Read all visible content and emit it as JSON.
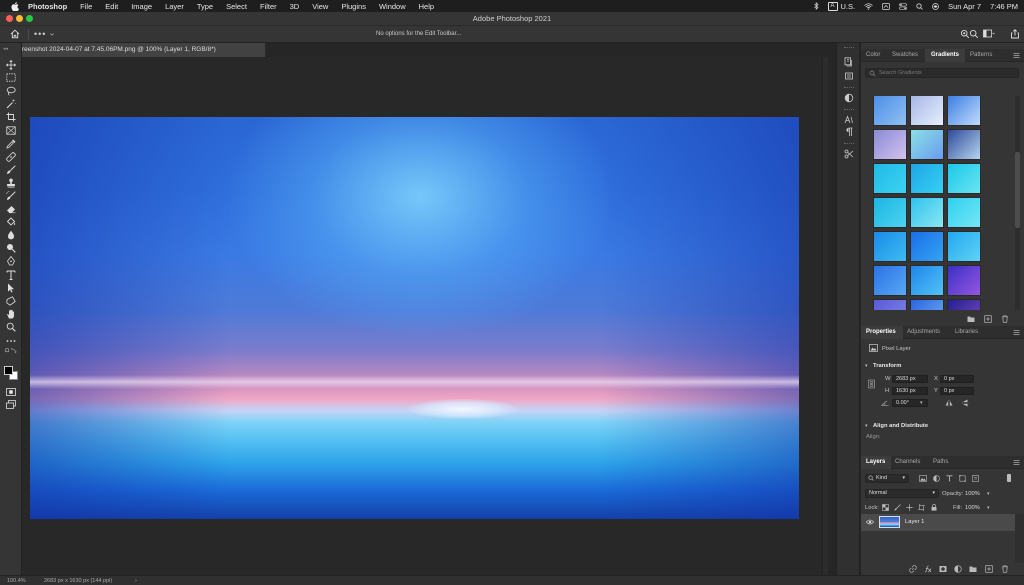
{
  "menubar": {
    "items": [
      "Photoshop",
      "File",
      "Edit",
      "Image",
      "Layer",
      "Type",
      "Select",
      "Filter",
      "3D",
      "View",
      "Plugins",
      "Window",
      "Help"
    ],
    "input_source": "A",
    "locale": "U.S.",
    "date": "Sun Apr 7",
    "time": "7:46 PM"
  },
  "window": {
    "title": "Adobe Photoshop 2021",
    "traffic_colors": [
      "#ff5f57",
      "#febc2e",
      "#28c840"
    ]
  },
  "options_bar": {
    "more_label": "•••",
    "message": "No options for the Edit Toolbar..."
  },
  "document": {
    "tab_title": "reenshot 2024-04-07 at 7.45.06PM.png @ 100% (Layer 1, RGB/8*)"
  },
  "status_bar": {
    "zoom": "100.4%",
    "dimensions": "2683 px x 1630 px (144 ppi)",
    "arrow": "›"
  },
  "gradients_panel": {
    "tabs": [
      "Color",
      "Swatches",
      "Gradients",
      "Patterns"
    ],
    "active_tab": "Gradients",
    "search_placeholder": "Search Gradients",
    "swatches": [
      [
        "#4d8ee6",
        "#8fc0f4"
      ],
      [
        "#a7b6e6",
        "#e6f0ff"
      ],
      [
        "#3a7fe0",
        "#c2dcff"
      ],
      [
        "#8a8ad6",
        "#d3c2ee"
      ],
      [
        "#8ae0e6",
        "#6a9cee"
      ],
      [
        "#2e4a9a",
        "#b6d4f0"
      ],
      [
        "#22b8e6",
        "#3ad4f2"
      ],
      [
        "#1ea6e6",
        "#36d0f4"
      ],
      [
        "#1cc8e6",
        "#6ae4f4"
      ],
      [
        "#1cb4e2",
        "#4cd4f2"
      ],
      [
        "#2ec2f0",
        "#8ae8f0"
      ],
      [
        "#30d0f0",
        "#74e6f6"
      ],
      [
        "#1c8ae6",
        "#3cbcf4"
      ],
      [
        "#1a6ee8",
        "#34a4f2"
      ],
      [
        "#22a8f0",
        "#60d2f6"
      ],
      [
        "#2a72e6",
        "#58a8f4"
      ],
      [
        "#1e86ec",
        "#52c2f4"
      ],
      [
        "#3a30c6",
        "#9656e0"
      ],
      [
        "#5a5ad8",
        "#7e8ae6"
      ],
      [
        "#2e62e2",
        "#6ab6f0"
      ],
      [
        "#24208e",
        "#7a4ac6"
      ]
    ]
  },
  "properties_panel": {
    "tabs": [
      "Properties",
      "Adjustments",
      "Libraries"
    ],
    "active_tab": "Properties",
    "layer_type": "Pixel Layer",
    "transform_heading": "Transform",
    "w_label": "W",
    "w_value": "2683 px",
    "h_label": "H",
    "h_value": "1630 px",
    "x_label": "X",
    "x_value": "0 px",
    "y_label": "Y",
    "y_value": "0 px",
    "angle_value": "0.00°",
    "align_heading": "Align and Distribute",
    "align_label": "Align:"
  },
  "layers_panel": {
    "tabs": [
      "Layers",
      "Channels",
      "Paths"
    ],
    "active_tab": "Layers",
    "filter_kind": "Kind",
    "blend_mode": "Normal",
    "opacity_label": "Opacity:",
    "opacity_value": "100%",
    "lock_label": "Lock:",
    "fill_label": "Fill:",
    "fill_value": "100%",
    "layer_name": "Layer 1"
  }
}
